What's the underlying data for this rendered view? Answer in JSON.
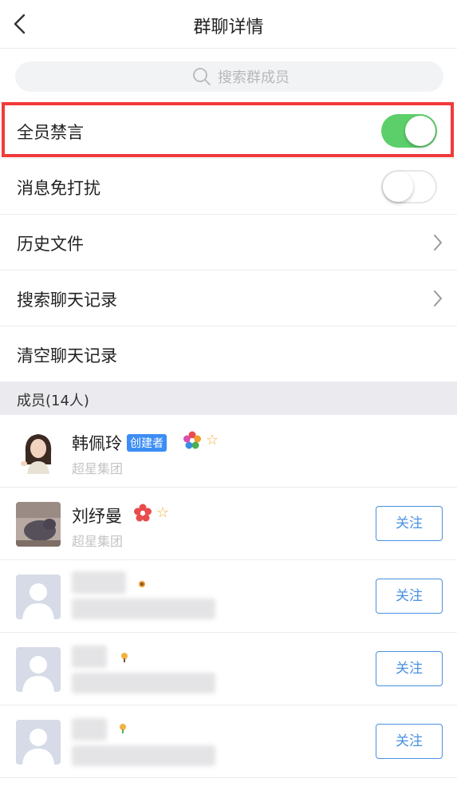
{
  "header": {
    "title": "群聊详情",
    "back_icon": "chevron-left-icon"
  },
  "search": {
    "placeholder": "搜索群成员",
    "icon": "search-icon"
  },
  "settings": {
    "mute_all": {
      "label": "全员禁言",
      "enabled": true
    },
    "do_not_disturb": {
      "label": "消息免打扰",
      "enabled": false
    },
    "history_files": {
      "label": "历史文件",
      "icon": "chevron-right-icon"
    },
    "search_history": {
      "label": "搜索聊天记录",
      "icon": "chevron-right-icon"
    },
    "clear_history": {
      "label": "清空聊天记录"
    }
  },
  "members_section": {
    "title": "成员(14人)"
  },
  "members": [
    {
      "name": "韩佩玲",
      "badge": "创建者",
      "org": "超星集团"
    },
    {
      "name": "刘纾曼",
      "org": "超星集团",
      "follow_label": "关注"
    },
    {
      "follow_label": "关注"
    },
    {
      "follow_label": "关注"
    },
    {
      "follow_label": "关注"
    }
  ],
  "colors": {
    "accent": "#4a90e2",
    "toggle_on": "#5ccf6a",
    "highlight": "#f23a3a",
    "badge": "#3c8ef5"
  }
}
